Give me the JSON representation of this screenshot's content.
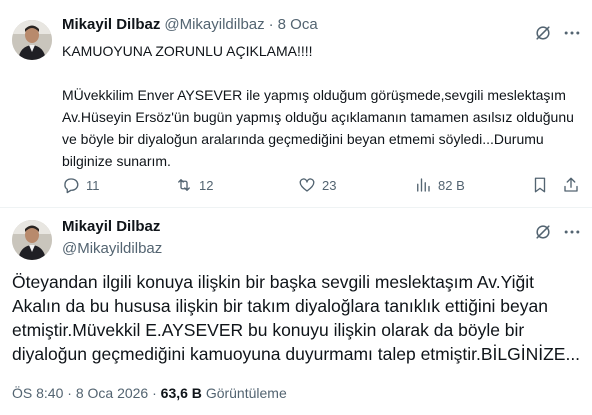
{
  "tweet1": {
    "author_name": "Mikayil Dilbaz",
    "author_handle": "@Mikayildilbaz",
    "separator": "·",
    "date": "8 Oca",
    "lines": [
      "KAMUOYUNA ZORUNLU AÇIKLAMA!!!!",
      "MÜvekkilim Enver AYSEVER ile yapmış olduğum görüşmede,sevgili meslektaşım  Av.Hüseyin Ersöz'ün bugün yapmış olduğu açıklamanın tamamen asılsız olduğunu ve böyle bir diyaloğun aralarında geçmediğini beyan etmemi söyledi...Durumu bilginize sunarım."
    ],
    "actions": {
      "replies": "11",
      "reposts": "12",
      "likes": "23",
      "views": "82 B"
    }
  },
  "tweet2": {
    "author_name": "Mikayil Dilbaz",
    "author_handle": "@Mikayildilbaz",
    "text": "Öteyandan ilgili konuya ilişkin bir başka sevgili meslektaşım Av.Yiğit Akalın da bu hususa ilişkin bir takım diyaloğlara tanıklık ettiğini beyan etmiştir.Müvekkil E.AYSEVER bu konuyu ilişkin olarak da böyle bir diyaloğun geçmediğini kamuoyuna duyurmamı talep etmiştir.BİLGİNİZE...",
    "time": "ÖS 8:40",
    "separator": "·",
    "date": "8 Oca 2026",
    "views_count": "63,6 B",
    "views_label": "Görüntüleme"
  },
  "icons": {
    "grok": "grok-icon",
    "more": "more-icon",
    "reply": "reply-icon",
    "repost": "repost-icon",
    "like": "like-icon",
    "views": "views-icon",
    "bookmark": "bookmark-icon",
    "share": "share-icon"
  },
  "colors": {
    "text": "#0f1419",
    "muted": "#536471",
    "divider": "#eff3f4"
  }
}
